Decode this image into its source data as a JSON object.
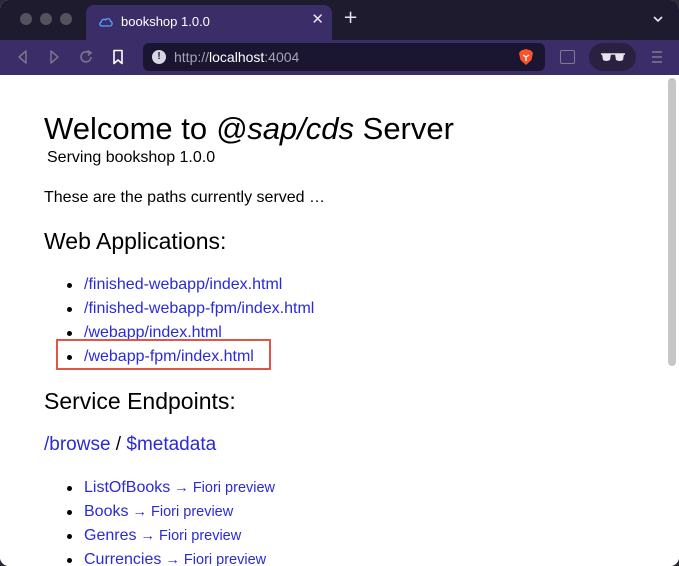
{
  "browser": {
    "tab": {
      "title": "bookshop 1.0.0"
    },
    "url": {
      "scheme": "http://",
      "host": "localhost",
      "port": ":4004"
    },
    "colors": {
      "tabbar": "#1f1b2e",
      "toolbar": "#3b2d67",
      "link": "#2a2ad8"
    }
  },
  "page": {
    "title_prefix": "Welcome to ",
    "title_em": "@sap/cds",
    "title_suffix": " Server",
    "subtitle": "Serving bookshop 1.0.0",
    "intro": "These are the paths currently served …",
    "webapps": {
      "heading": "Web Applications:",
      "links": [
        "/finished-webapp/index.html",
        "/finished-webapp-fpm/index.html",
        "/webapp/index.html",
        "/webapp-fpm/index.html"
      ]
    },
    "services": {
      "heading": "Service Endpoints:",
      "browse": "/browse",
      "separator": " / ",
      "metadata": "$metadata",
      "entities": [
        {
          "name": "ListOfBooks",
          "arrow": " → ",
          "preview": "Fiori preview"
        },
        {
          "name": "Books",
          "arrow": " → ",
          "preview": "Fiori preview"
        },
        {
          "name": "Genres",
          "arrow": " → ",
          "preview": "Fiori preview"
        },
        {
          "name": "Currencies",
          "arrow": " → ",
          "preview": "Fiori preview"
        }
      ]
    }
  }
}
